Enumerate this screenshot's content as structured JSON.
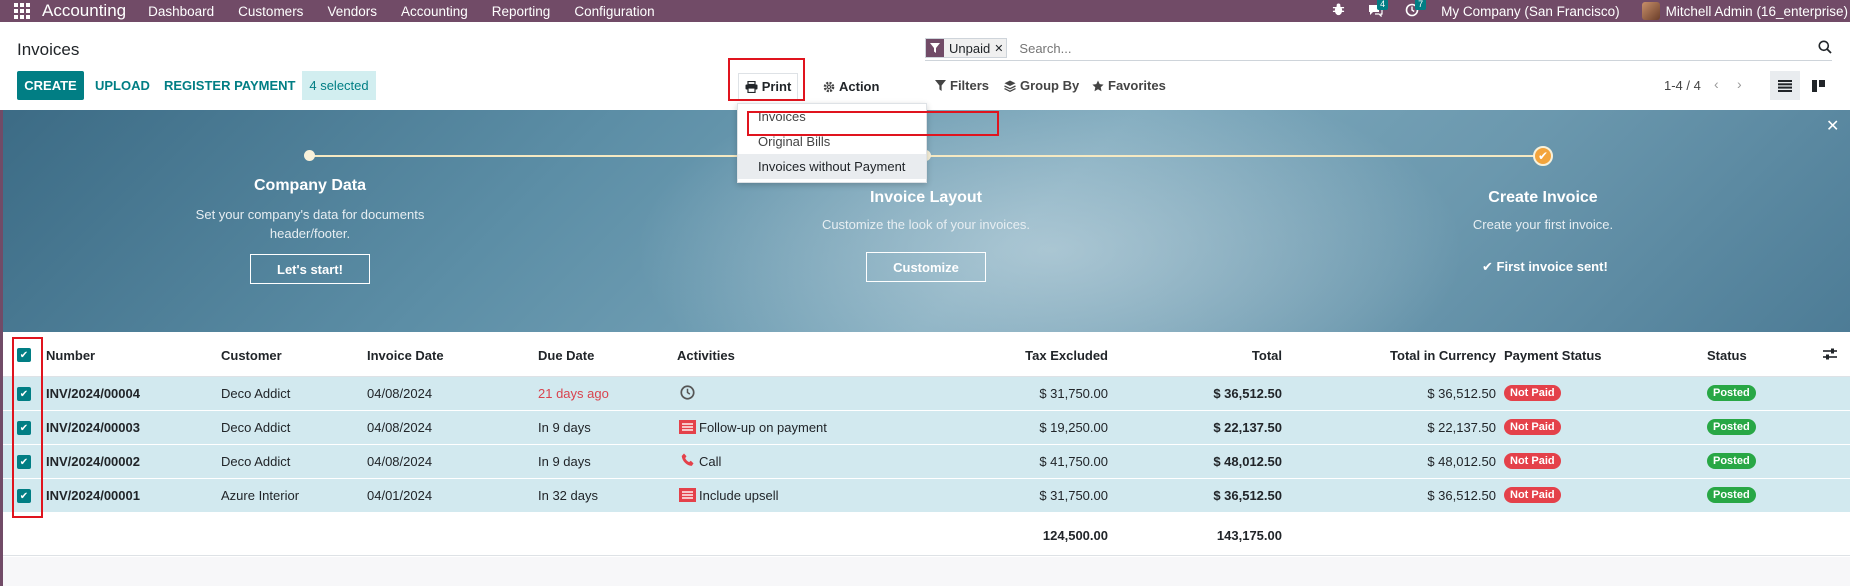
{
  "navbar": {
    "brand": "Accounting",
    "menu": [
      "Dashboard",
      "Customers",
      "Vendors",
      "Accounting",
      "Reporting",
      "Configuration"
    ],
    "chat_count": "4",
    "activity_count": "7",
    "company": "My Company (San Francisco)",
    "user": "Mitchell Admin (16_enterprise)"
  },
  "control": {
    "title": "Invoices",
    "create": "CREATE",
    "upload": "UPLOAD",
    "register_payment": "REGISTER PAYMENT",
    "selected": "4 selected",
    "print": "Print",
    "action": "Action",
    "filters": "Filters",
    "group_by": "Group By",
    "favorites": "Favorites",
    "pager": "1-4 / 4"
  },
  "search": {
    "facet": "Unpaid",
    "placeholder": "Search..."
  },
  "print_menu": [
    "Invoices",
    "Original Bills",
    "Invoices without Payment"
  ],
  "banner": {
    "steps": [
      {
        "title": "Company Data",
        "desc": "Set your company's data for documents header/footer.",
        "button": "Let's start!"
      },
      {
        "title": "Invoice Layout",
        "desc": "Customize the look of your invoices.",
        "button": "Customize"
      },
      {
        "title": "Create Invoice",
        "desc": "Create your first invoice.",
        "done": "First invoice sent!"
      }
    ]
  },
  "table": {
    "columns": [
      "Number",
      "Customer",
      "Invoice Date",
      "Due Date",
      "Activities",
      "Tax Excluded",
      "Total",
      "Total in Currency",
      "Payment Status",
      "Status"
    ],
    "rows": [
      {
        "number": "INV/2024/00004",
        "customer": "Deco Addict",
        "invoice_date": "04/08/2024",
        "due_date": "21 days ago",
        "activity": "",
        "activity_icon": "clock-icon",
        "tax_excluded": "$ 31,750.00",
        "total": "$ 36,512.50",
        "total_currency": "$ 36,512.50",
        "payment_status": "Not Paid",
        "status": "Posted"
      },
      {
        "number": "INV/2024/00003",
        "customer": "Deco Addict",
        "invoice_date": "04/08/2024",
        "due_date": "In 9 days",
        "activity": "Follow-up on payment",
        "activity_icon": "todo-icon",
        "tax_excluded": "$ 19,250.00",
        "total": "$ 22,137.50",
        "total_currency": "$ 22,137.50",
        "payment_status": "Not Paid",
        "status": "Posted"
      },
      {
        "number": "INV/2024/00002",
        "customer": "Deco Addict",
        "invoice_date": "04/08/2024",
        "due_date": "In 9 days",
        "activity": "Call",
        "activity_icon": "phone-icon",
        "tax_excluded": "$ 41,750.00",
        "total": "$ 48,012.50",
        "total_currency": "$ 48,012.50",
        "payment_status": "Not Paid",
        "status": "Posted"
      },
      {
        "number": "INV/2024/00001",
        "customer": "Azure Interior",
        "invoice_date": "04/01/2024",
        "due_date": "In 32 days",
        "activity": "Include upsell",
        "activity_icon": "todo-icon",
        "tax_excluded": "$ 31,750.00",
        "total": "$ 36,512.50",
        "total_currency": "$ 36,512.50",
        "payment_status": "Not Paid",
        "status": "Posted"
      }
    ],
    "totals": {
      "tax_excluded": "124,500.00",
      "total": "143,175.00"
    }
  },
  "colors": {
    "brand": "#714B67",
    "accent": "#017e84",
    "highlight": "#e0141e"
  }
}
